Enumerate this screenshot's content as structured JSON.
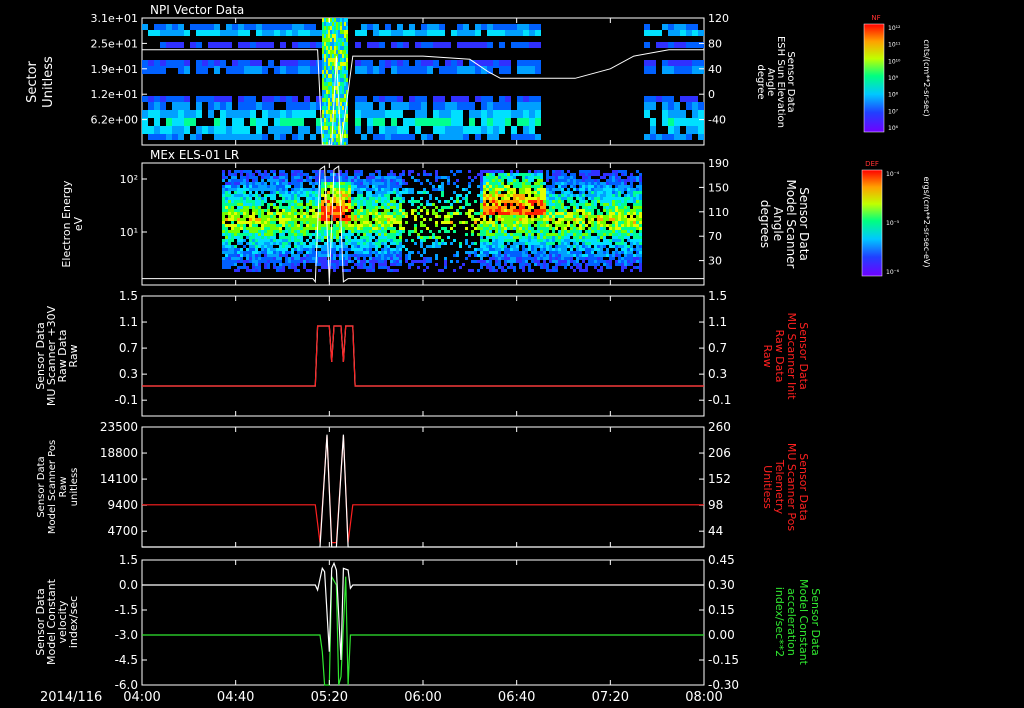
{
  "date_label": "2014/116",
  "x_ticks": [
    "04:00",
    "04:40",
    "05:20",
    "06:00",
    "06:40",
    "07:20",
    "08:00"
  ],
  "chart_data": [
    {
      "type": "heatmap",
      "title": "NPI Vector Data",
      "ylabel": [
        "Sector",
        "Unitless"
      ],
      "y_ticks": [
        "3.1e+01",
        "2.5e+01",
        "1.9e+01",
        "1.2e+01",
        "6.2e+00"
      ],
      "right_ylabel": [
        "Sensor Data",
        "ESH Sun Elevation",
        "Angle",
        "degree"
      ],
      "right_ticks": [
        "120",
        "80",
        "40",
        "0",
        "-40"
      ],
      "right_ylim": [
        -80,
        120
      ],
      "overlay_series": {
        "name": "ESH Sun Elevation Angle",
        "color": "#ffffff",
        "x": [
          "04:00",
          "04:40",
          "05:15",
          "05:17",
          "05:21",
          "05:23",
          "05:25",
          "05:30",
          "06:00",
          "06:20",
          "06:28",
          "06:33",
          "06:40",
          "07:00",
          "07:05",
          "07:20",
          "07:30",
          "07:45",
          "08:00"
        ],
        "y": [
          70,
          70,
          70,
          -80,
          -80,
          60,
          -80,
          60,
          60,
          55,
          35,
          25,
          25,
          25,
          25,
          40,
          60,
          70,
          70
        ]
      },
      "colorbar": {
        "title": "NF",
        "units": "cnts/(cm**2-sr-sec)",
        "ticks": [
          "10¹²",
          "10¹¹",
          "10¹⁰",
          "10⁹",
          "10⁸",
          "10⁷",
          "10⁶"
        ]
      }
    },
    {
      "type": "heatmap",
      "title": "MEx ELS-01 LR",
      "ylabel": [
        "Electron Energy",
        "eV"
      ],
      "y_ticks": [
        "10²",
        "10¹"
      ],
      "right_ylabel": [
        "Sensor Data",
        "Model Scanner",
        "Angle",
        "degrees"
      ],
      "right_ticks": [
        "190",
        "150",
        "110",
        "70",
        "30"
      ],
      "right_ylim": [
        0,
        190
      ],
      "overlay_series": {
        "name": "Model Scanner Angle",
        "color": "#ffffff",
        "x": [
          "04:00",
          "05:13",
          "05:14",
          "05:16",
          "05:18",
          "05:20",
          "05:22",
          "05:24",
          "05:26",
          "05:28",
          "05:30",
          "08:00"
        ],
        "y": [
          10,
          10,
          5,
          180,
          185,
          5,
          180,
          185,
          5,
          10,
          10,
          10
        ]
      },
      "colorbar": {
        "title": "DEF",
        "units": "ergs/(cm**2-sr-sec-eV)",
        "ticks": [
          "10⁻⁴",
          "10⁻⁵",
          "10⁻⁶"
        ]
      }
    },
    {
      "type": "line",
      "ylabel": [
        "Sensor Data",
        "MU Scanner +30V",
        "Raw Data",
        "Raw"
      ],
      "y_ticks": [
        "1.5",
        "1.1",
        "0.7",
        "0.3",
        "-0.1"
      ],
      "ylim": [
        -0.5,
        1.5
      ],
      "right_ylabel": [
        "Sensor Data",
        "MU Scanner Init",
        "Raw Data",
        "Raw"
      ],
      "right_ylabel_color": "#ff2020",
      "right_ticks": [
        "1.5",
        "1.1",
        "0.7",
        "0.3",
        "-0.1"
      ],
      "series": [
        {
          "name": "MU Scanner +30V Raw Data",
          "color": "#ffffff",
          "x": [
            "04:00",
            "05:14",
            "05:15",
            "05:16",
            "05:20",
            "05:21",
            "05:22",
            "05:25",
            "05:26",
            "05:27",
            "05:30",
            "05:31",
            "08:00"
          ],
          "y": [
            0,
            0,
            1,
            1,
            1,
            0.4,
            1,
            1,
            0.4,
            1,
            1,
            0,
            0
          ]
        },
        {
          "name": "MU Scanner Init Raw Data",
          "color": "#ff2020",
          "x": [
            "04:00",
            "05:14",
            "05:15",
            "05:16",
            "05:20",
            "05:21",
            "05:22",
            "05:25",
            "05:26",
            "05:27",
            "05:30",
            "05:31",
            "08:00"
          ],
          "y": [
            0,
            0,
            1,
            1,
            1,
            0.4,
            1,
            1,
            0.4,
            1,
            1,
            0,
            0
          ]
        }
      ]
    },
    {
      "type": "line",
      "ylabel": [
        "Sensor Data",
        "Model Scanner Pos",
        "Raw",
        "unitless"
      ],
      "y_ticks": [
        "23500",
        "18800",
        "14100",
        "9400",
        "4700"
      ],
      "ylim": [
        0,
        23500
      ],
      "right_ylabel": [
        "Sensor Data",
        "MU Scanner Pos",
        "Telemetry",
        "Unitless"
      ],
      "right_ylabel_color": "#ff2020",
      "right_ticks": [
        "260",
        "206",
        "152",
        "98",
        "44"
      ],
      "right_ylim": [
        -10,
        260
      ],
      "series": [
        {
          "name": "Model Scanner Pos",
          "color": "#ffffff",
          "x": [
            "04:00",
            "05:14",
            "05:16",
            "05:19",
            "05:21",
            "05:23",
            "05:26",
            "05:28",
            "05:30",
            "08:00"
          ],
          "y": [
            0,
            0,
            0,
            22000,
            0,
            0,
            22000,
            0,
            0,
            0
          ]
        },
        {
          "name": "MU Scanner Pos Telemetry",
          "color": "#ff2020",
          "x": [
            "04:00",
            "05:14",
            "05:16",
            "05:19",
            "05:21",
            "05:23",
            "05:26",
            "05:28",
            "05:30",
            "08:00"
          ],
          "y": [
            85,
            85,
            0,
            240,
            0,
            0,
            240,
            0,
            85,
            85
          ]
        }
      ]
    },
    {
      "type": "line",
      "ylabel": [
        "Sensor Data",
        "Model Constant",
        "velocity",
        "index/sec"
      ],
      "y_ticks": [
        "1.5",
        "0.0",
        "-1.5",
        "-3.0",
        "-4.5",
        "-6.0"
      ],
      "ylim": [
        -6,
        1.5
      ],
      "right_ylabel": [
        "Sensor Data",
        "Model Constant",
        "acceleration",
        "index/sec**2"
      ],
      "right_ylabel_color": "#30e830",
      "right_ticks": [
        "0.45",
        "0.30",
        "0.15",
        "0.00",
        "-0.15",
        "-0.30"
      ],
      "right_ylim": [
        -0.3,
        0.45
      ],
      "series": [
        {
          "name": "Model Constant velocity",
          "color": "#ffffff",
          "x": [
            "04:00",
            "05:14",
            "05:15",
            "05:17",
            "05:18",
            "05:20",
            "05:21",
            "05:22",
            "05:23",
            "05:25",
            "05:26",
            "05:28",
            "05:29",
            "05:30",
            "08:00"
          ],
          "y": [
            0,
            0,
            -0.3,
            1.0,
            0.8,
            -4,
            1.0,
            1.3,
            0.9,
            -4.5,
            1.0,
            0.9,
            -0.2,
            0,
            0
          ]
        },
        {
          "name": "Model Constant acceleration",
          "color": "#30e830",
          "x": [
            "04:00",
            "05:16",
            "05:17",
            "05:18",
            "05:20",
            "05:21",
            "05:23",
            "05:24",
            "05:25",
            "05:27",
            "05:28",
            "05:29",
            "08:00"
          ],
          "y": [
            0,
            0,
            -0.1,
            -0.3,
            -0.3,
            0.35,
            0.3,
            -0.3,
            -0.25,
            0.35,
            -0.3,
            0,
            0
          ]
        }
      ]
    }
  ]
}
